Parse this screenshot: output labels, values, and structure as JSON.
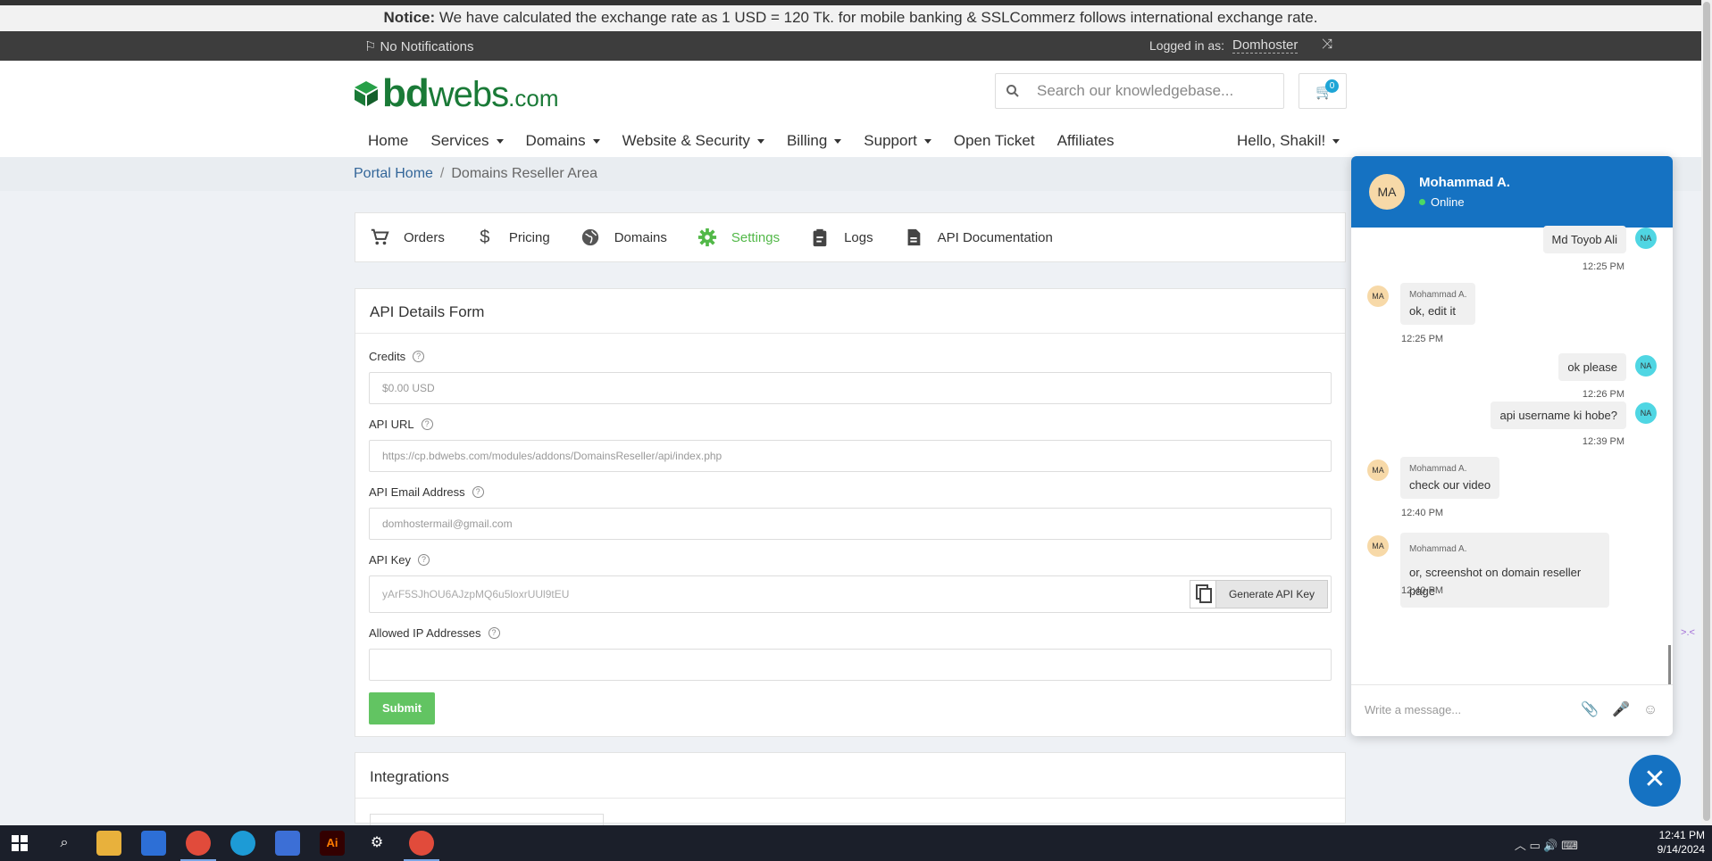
{
  "notice": {
    "label": "Notice:",
    "text": "We have calculated the exchange rate as 1 USD = 120 Tk. for mobile banking & SSLCommerz follows international exchange rate."
  },
  "topbar": {
    "notifications": "No Notifications",
    "logged_in_label": "Logged in as:",
    "username": "Domhoster"
  },
  "brand": {
    "bd": "bd",
    "webs": "webs",
    "com": ".com"
  },
  "search": {
    "placeholder": "Search our knowledgebase..."
  },
  "cart": {
    "count": "0"
  },
  "nav": {
    "items": [
      "Home",
      "Services",
      "Domains",
      "Website & Security",
      "Billing",
      "Support",
      "Open Ticket",
      "Affiliates"
    ],
    "greeting": "Hello, Shakil!"
  },
  "breadcrumb": {
    "home": "Portal Home",
    "current": "Domains Reseller Area"
  },
  "tabs": [
    "Orders",
    "Pricing",
    "Domains",
    "Settings",
    "Logs",
    "API Documentation"
  ],
  "form": {
    "title": "API Details Form",
    "credits_label": "Credits",
    "credits_value": "$0.00 USD",
    "api_url_label": "API URL",
    "api_url_value": "https://cp.bdwebs.com/modules/addons/DomainsReseller/api/index.php",
    "email_label": "API Email Address",
    "email_value": "domhostermail@gmail.com",
    "key_label": "API Key",
    "key_value": "yArF5SJhOU6AJzpMQ6u5loxrUUl9tEU",
    "generate_label": "Generate API Key",
    "ip_label": "Allowed IP Addresses",
    "ip_value": "",
    "submit_label": "Submit"
  },
  "integrations": {
    "title": "Integrations"
  },
  "chat": {
    "agent_initials": "MA",
    "agent_name": "Mohammad A.",
    "status": "Online",
    "user_initials": "NA",
    "messages": [
      {
        "from": "user",
        "text": "Md Toyob Ali",
        "time": "12:25 PM"
      },
      {
        "from": "agent",
        "name": "Mohammad A.",
        "text": "ok, edit it",
        "time": "12:25 PM"
      },
      {
        "from": "user",
        "text": "ok please",
        "time": "12:26 PM"
      },
      {
        "from": "user",
        "text": "api username ki hobe?",
        "time": "12:39 PM"
      },
      {
        "from": "agent",
        "name": "Mohammad A.",
        "text": "check our video",
        "time": "12:40 PM"
      },
      {
        "from": "agent",
        "name": "Mohammad A.",
        "text": "or, screenshot on domain reseller page",
        "time": "12:40 PM"
      }
    ],
    "compose_placeholder": "Write a message..."
  },
  "taskbar": {
    "time": "12:41 PM",
    "date": "9/14/2024"
  },
  "colors": {
    "brand_green": "#1a7a37",
    "chat_blue": "#1572c2",
    "active_tab": "#52b848",
    "submit": "#62c462"
  }
}
